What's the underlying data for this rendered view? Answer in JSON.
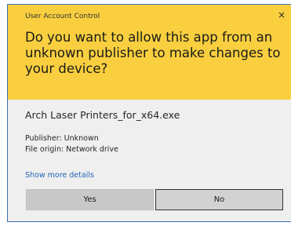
{
  "dialog": {
    "title": "User Account Control",
    "close_glyph": "×",
    "question": "Do you want to allow this app from an unknown publisher to make changes to your device?",
    "app_name": "Arch Laser Printers_for_x64.exe",
    "publisher": "Publisher: Unknown",
    "file_origin": "File origin: Network drive",
    "show_more_details": "Show more details",
    "yes_label": "Yes",
    "no_label": "No"
  },
  "colors": {
    "header_yellow": "#f9cf3f",
    "body_gray": "#efefef",
    "link_blue": "#1f62b8",
    "frame_blue": "#3d6bb4"
  },
  "icons": {
    "close": "close-icon"
  }
}
